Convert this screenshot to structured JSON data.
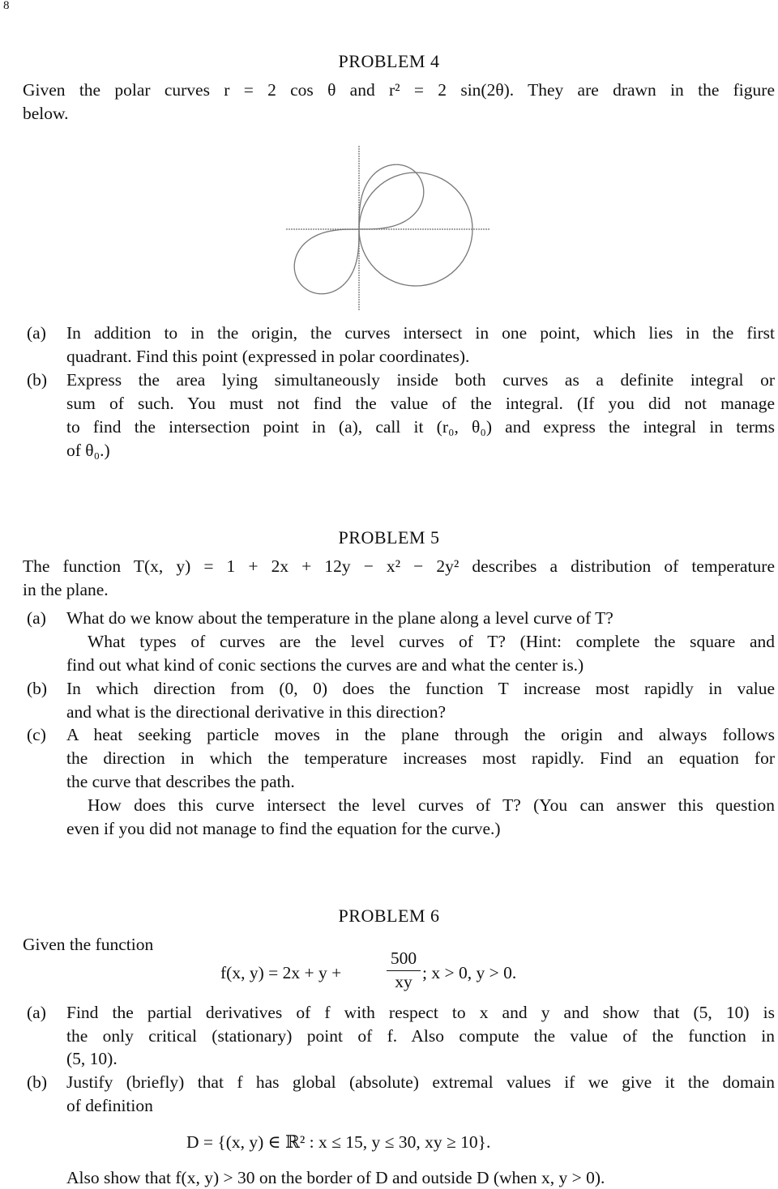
{
  "page_number": "8",
  "problem4": {
    "title": "PROBLEM 4",
    "intro": [
      "Given the polar curves r = 2 cos θ and r² = 2 sin(2θ). They are drawn in the figure",
      "below."
    ],
    "a_label": "(a)",
    "a": [
      "In addition to in the origin, the curves intersect in one point, which lies in the first",
      "quadrant. Find this point (expressed in polar coordinates)."
    ],
    "b_label": "(b)",
    "b": [
      "Express the area lying simultaneously inside both curves as a definite integral or",
      "sum of such. You must not find the value of the integral. (If you did not manage",
      "to find the intersection point in (a), call it (r₀, θ₀) and express the integral in terms",
      "of θ₀.)"
    ]
  },
  "problem5": {
    "title": "PROBLEM 5",
    "intro": [
      "The function T(x, y) = 1 + 2x + 12y − x² − 2y² describes a distribution of temperature",
      "in the plane."
    ],
    "a_label": "(a)",
    "a": [
      "What do we know about the temperature in the plane along a level curve of T?",
      "What types of curves are the level curves of T? (Hint: complete the square and",
      "find out what kind of conic sections the curves are and what the center is.)"
    ],
    "b_label": "(b)",
    "b": [
      "In which direction from (0, 0) does the function T increase most rapidly in value",
      "and what is the directional derivative in this direction?"
    ],
    "c_label": "(c)",
    "c": [
      "A heat seeking particle moves in the plane through the origin and always follows",
      "the direction in which the temperature increases most rapidly. Find an equation for",
      "the curve that describes the path.",
      "How does this curve intersect the level curves of T? (You can answer this question",
      "even if you did not manage to find the equation for the curve.)"
    ]
  },
  "problem6": {
    "title": "PROBLEM 6",
    "intro": "Given the function",
    "formula_left": "f(x, y) = 2x + y +",
    "formula_num": "500",
    "formula_den": "xy",
    "formula_right": "; x > 0, y > 0.",
    "a_label": "(a)",
    "a": [
      "Find the partial derivatives of f with respect to x and y and show that (5, 10) is",
      "the only critical (stationary) point of f. Also compute the value of the function in",
      "(5, 10)."
    ],
    "b_label": "(b)",
    "b": [
      "Justify (briefly) that f has global (absolute) extremal values if we give it the domain",
      "of definition"
    ],
    "domain": "D = {(x, y) ∈ ℝ² : x ≤ 15, y ≤ 30, xy ≥ 10}.",
    "closing": "Also show that f(x, y) > 30 on the border of D and outside D (when x, y > 0)."
  },
  "figure": {
    "curves": [
      "r = 2 cos θ",
      "r² = 2 sin(2θ)"
    ],
    "stroke_color": "#777777"
  }
}
